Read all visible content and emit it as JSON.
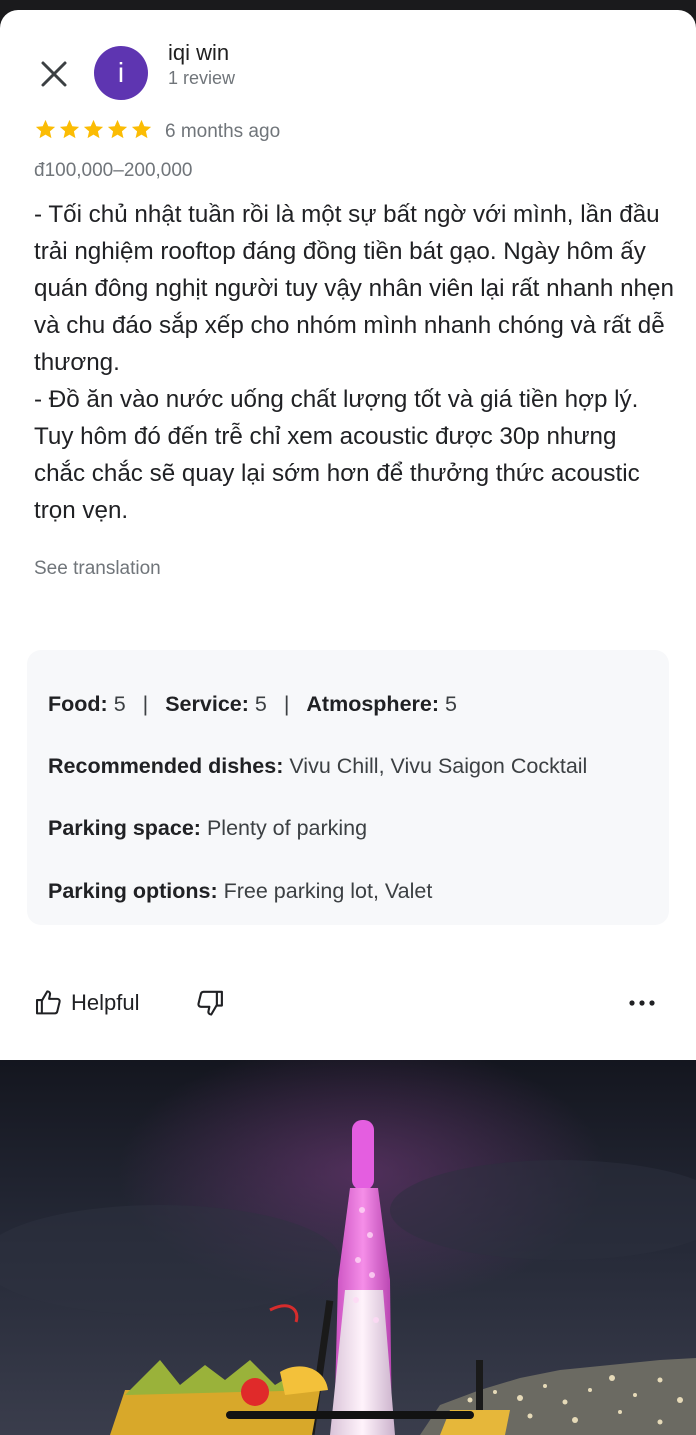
{
  "review": {
    "author_name": "iqi win",
    "author_initial": "i",
    "author_review_count": "1 review",
    "rating_stars": 5,
    "time": "6 months ago",
    "price_range": "đ100,000–200,000",
    "text": "- Tối chủ nhật tuần rồi là một sự bất ngờ với mình, lần đầu trải nghiệm rooftop đáng đồng tiền bát gạo. Ngày hôm ấy quán đông nghịt người tuy vậy nhân viên lại rất nhanh nhẹn và chu đáo sắp xếp cho nhóm mình nhanh chóng và rất dễ thương.\n- Đồ ăn vào nước uống chất lượng tốt và giá tiền hợp lý. Tuy hôm đó đến trễ chỉ xem acoustic được 30p nhưng chắc chắc sẽ quay lại sớm hơn để thưởng thức acoustic trọn vẹn.",
    "see_translation": "See translation"
  },
  "attributes": {
    "ratings": [
      {
        "label": "Food:",
        "value": "5"
      },
      {
        "label": "Service:",
        "value": "5"
      },
      {
        "label": "Atmosphere:",
        "value": "5"
      }
    ],
    "separator": "|",
    "recommended": {
      "label": "Recommended dishes:",
      "value": "Vivu Chill, Vivu Saigon Cocktail"
    },
    "parking_space": {
      "label": "Parking space:",
      "value": "Plenty of parking"
    },
    "parking_options": {
      "label": "Parking options:",
      "value": "Free parking lot, Valet"
    }
  },
  "actions": {
    "helpful_label": "Helpful"
  },
  "icons": [
    "close-icon",
    "star-icon",
    "thumbs-up-icon",
    "thumbs-down-icon",
    "more-horizontal-icon"
  ],
  "colors": {
    "avatar": "#5e35b1",
    "star": "#fbbc04",
    "secondary_text": "#70757a",
    "attr_box_bg": "#f7f8fa"
  }
}
